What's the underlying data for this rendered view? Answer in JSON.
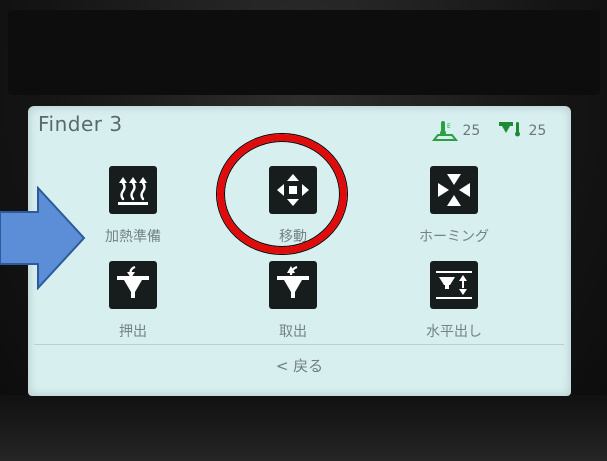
{
  "screen": {
    "title": "Finder 3",
    "bed_temp": "25",
    "nozzle_temp": "25",
    "back_label": "< 戻る"
  },
  "menu": {
    "items": [
      {
        "label": "加熱準備",
        "icon": "heat-icon"
      },
      {
        "label": "移動",
        "icon": "move-arrows-icon"
      },
      {
        "label": "ホーミング",
        "icon": "homing-icon"
      },
      {
        "label": "押出",
        "icon": "extrude-icon"
      },
      {
        "label": "取出",
        "icon": "retract-icon"
      },
      {
        "label": "水平出し",
        "icon": "leveling-icon"
      }
    ]
  },
  "annotations": {
    "highlight_color": "#e00c0c",
    "arrow_color": "#5b8ed6"
  },
  "colors": {
    "screen_bg": "#d8efef",
    "tile_bg": "#171d1d",
    "text": "#748383",
    "bed_icon": "#2aa043",
    "nozzle_icon": "#1f8a36"
  }
}
